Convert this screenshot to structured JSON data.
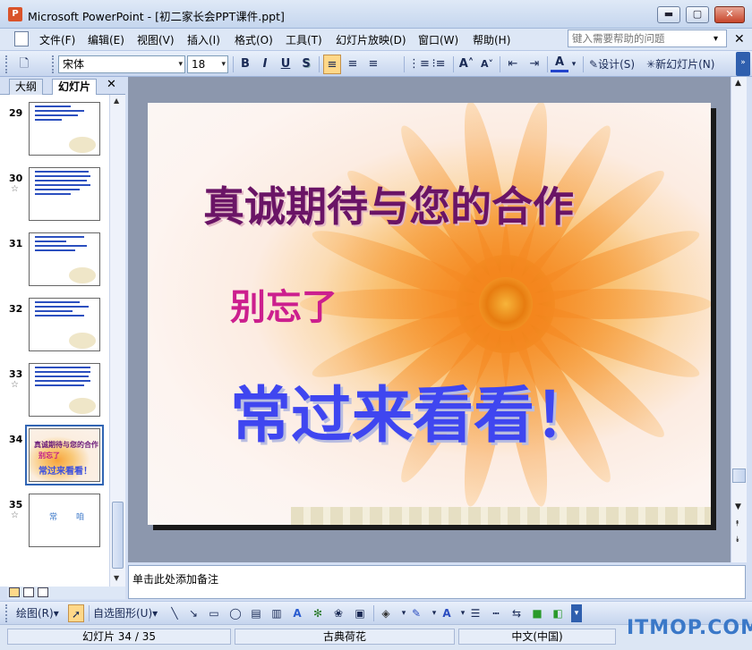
{
  "window": {
    "app_icon": "P",
    "title": "Microsoft PowerPoint - [初二家长会PPT课件.ppt]",
    "minimize": "▬",
    "maximize": "▢",
    "close": "✕"
  },
  "menu": {
    "items": [
      "文件(F)",
      "编辑(E)",
      "视图(V)",
      "插入(I)",
      "格式(O)",
      "工具(T)",
      "幻灯片放映(D)",
      "窗口(W)",
      "帮助(H)"
    ],
    "help_placeholder": "键入需要帮助的问题",
    "help_arrow": "▾",
    "close_doc": "✕"
  },
  "toolbar": {
    "new_icon": "🗋",
    "font_name": "宋体",
    "font_size": "18",
    "bold": "B",
    "italic": "I",
    "underline": "U",
    "shadow": "S",
    "align_left": "≡",
    "align_center": "≡",
    "align_right": "≡",
    "numbering": "⋮≡",
    "bullets": "⁝≡",
    "grow_font": "A˄",
    "shrink_font": "A˅",
    "decrease_indent": "⇤",
    "increase_indent": "⇥",
    "font_color": "A",
    "design_label": "设计(S)",
    "new_slide_label": "新幻灯片(N)",
    "more": "»"
  },
  "slide_pane": {
    "tabs": [
      "大纲",
      "幻灯片"
    ],
    "close": "✕",
    "star": "☆",
    "slides": [
      {
        "num": "29",
        "star": false
      },
      {
        "num": "30",
        "star": true
      },
      {
        "num": "31",
        "star": false
      },
      {
        "num": "32",
        "star": false
      },
      {
        "num": "33",
        "star": true
      },
      {
        "num": "34",
        "star": false
      },
      {
        "num": "35",
        "star": true
      }
    ],
    "thumb34": {
      "line1": "真诚期待与您的合作",
      "line2": "别忘了",
      "line3": "常过来看看！"
    },
    "thumb35": {
      "left": "常",
      "right": "咱"
    }
  },
  "slide": {
    "title": "真诚期待与您的合作",
    "subtitle": "别忘了",
    "big_text": "常过来看看！"
  },
  "scroll": {
    "up": "▲",
    "down": "▼",
    "prev": "⯭",
    "next": "⯯"
  },
  "notes_placeholder": "单击此处添加备注",
  "drawing_toolbar": {
    "draw_label": "绘图(R)",
    "autoshape_label": "自选图形(U)",
    "dropdown": "▾"
  },
  "status": {
    "slide_info": "幻灯片 34 / 35",
    "design": "古典荷花",
    "language": "中文(中国)"
  },
  "watermark": "ITMOP.COM"
}
